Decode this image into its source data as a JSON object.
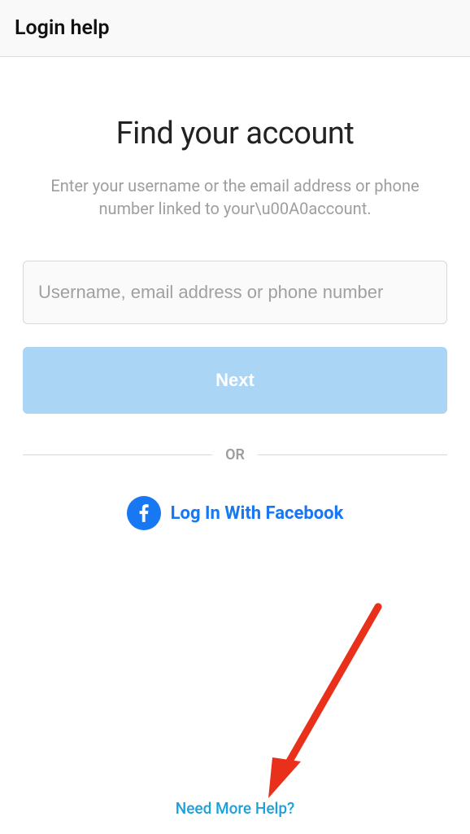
{
  "header": {
    "title": "Login help"
  },
  "main": {
    "title": "Find your account",
    "subtitle": "Enter your username or the email address or phone number linked to your\\u00A0account.",
    "input_placeholder": "Username, email address or phone number",
    "next_button": "Next",
    "divider": "OR",
    "facebook_label": "Log In With Facebook"
  },
  "footer": {
    "need_help": "Need More Help?"
  }
}
